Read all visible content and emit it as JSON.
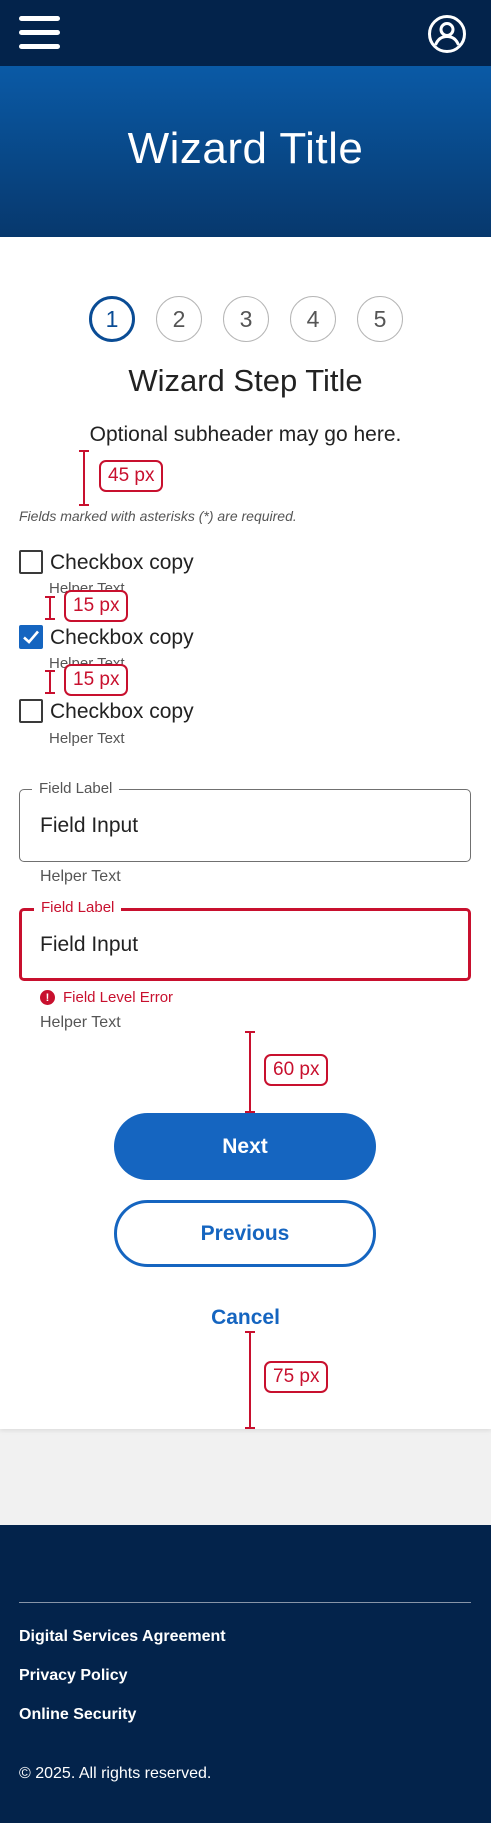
{
  "header": {
    "menu_icon": "hamburger-menu-icon",
    "account_icon": "user-account-icon"
  },
  "banner": {
    "title": "Wizard Title"
  },
  "stepper": {
    "steps": [
      "1",
      "2",
      "3",
      "4",
      "5"
    ],
    "active_step": "1"
  },
  "wizard": {
    "step_title": "Wizard Step Title",
    "subheader": "Optional subheader may go here.",
    "required_note": "Fields marked with asterisks (*) are required."
  },
  "checkboxes": [
    {
      "label": "Checkbox copy",
      "helper": "Helper Text",
      "checked": false
    },
    {
      "label": "Checkbox copy",
      "helper": "Helper Text",
      "checked": true
    },
    {
      "label": "Checkbox copy",
      "helper": "Helper Text",
      "checked": false
    }
  ],
  "fields": [
    {
      "label": "Field Label",
      "value": "Field Input",
      "helper": "Helper Text"
    },
    {
      "label": "Field Label",
      "value": "Field Input",
      "helper": "Helper Text",
      "error": "Field Level Error"
    }
  ],
  "actions": {
    "next": "Next",
    "previous": "Previous",
    "cancel": "Cancel"
  },
  "annotations": {
    "spacing_45": "45 px",
    "spacing_15a": "15 px",
    "spacing_15b": "15 px",
    "spacing_60": "60 px",
    "spacing_75": "75 px"
  },
  "footer": {
    "links": [
      "Digital Services Agreement",
      "Privacy Policy",
      "Online Security"
    ],
    "copyright": "© 2025. All rights reserved."
  },
  "colors": {
    "navy": "#03234b",
    "primary": "#1565c0",
    "error": "#c8102e"
  }
}
